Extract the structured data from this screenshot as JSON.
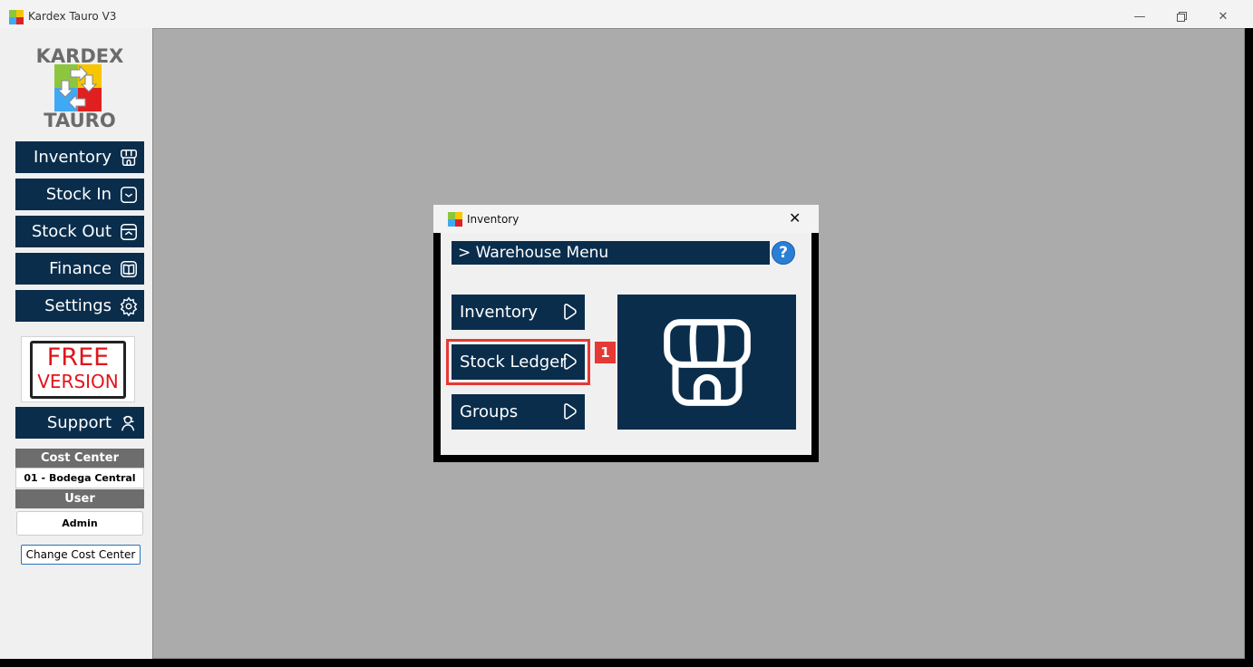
{
  "window": {
    "title": "Kardex Tauro V3",
    "min_icon": "minimize-icon",
    "max_icon": "restore-icon",
    "close_icon": "close-icon"
  },
  "logo": {
    "top_word": "KARDEX",
    "bottom_word": "TAURO"
  },
  "sidebar": {
    "items": [
      {
        "label": "Inventory",
        "icon": "storefront-icon"
      },
      {
        "label": "Stock In",
        "icon": "tray-in-icon"
      },
      {
        "label": "Stock Out",
        "icon": "tray-out-icon"
      },
      {
        "label": "Finance",
        "icon": "book-icon"
      },
      {
        "label": "Settings",
        "icon": "gear-icon"
      }
    ],
    "free": {
      "line1": "FREE",
      "line2": "VERSION"
    },
    "support": {
      "label": "Support",
      "icon": "agent-icon"
    },
    "cost_center": {
      "header": "Cost Center",
      "value": "01 - Bodega Central"
    },
    "user": {
      "header": "User",
      "value": "Admin"
    },
    "change_button": "Change Cost Center"
  },
  "dialog": {
    "title": "Inventory",
    "menu_title": "> Warehouse Menu",
    "help": "?",
    "buttons": [
      {
        "label": "Inventory",
        "icon": "play-circle-icon"
      },
      {
        "label": "Stock Ledger",
        "icon": "play-circle-icon"
      },
      {
        "label": "Groups",
        "icon": "play-circle-icon"
      }
    ],
    "badge": "1",
    "tile_icon": "storefront-icon"
  },
  "colors": {
    "navy": "#0a2d4c",
    "highlight": "#e53935",
    "workspace": "#ababab"
  }
}
